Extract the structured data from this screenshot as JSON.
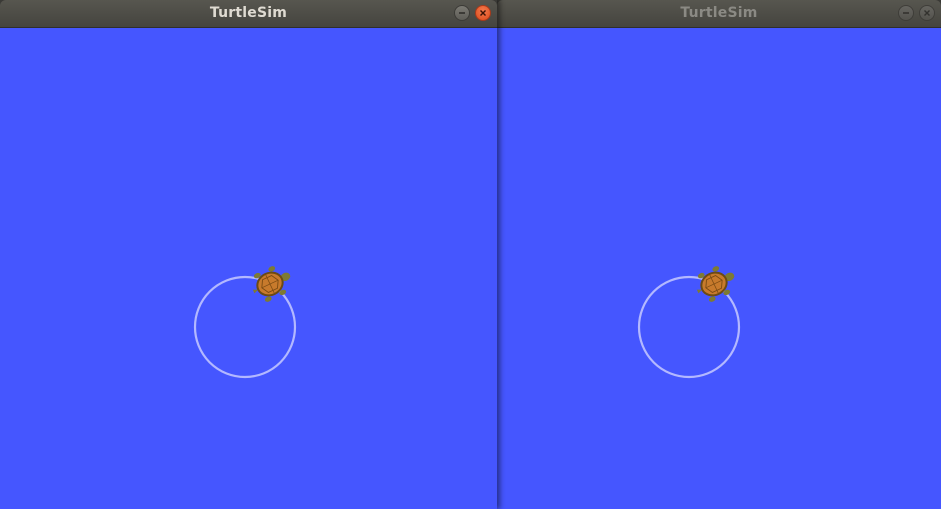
{
  "windows": [
    {
      "title": "TurtleSim",
      "state": "active",
      "background_color": "#4556ff",
      "pen_color": "#b3b8ff",
      "buttons": {
        "minimize": "minimize-icon",
        "close": "close-icon"
      }
    },
    {
      "title": "TurtleSim",
      "state": "inactive",
      "background_color": "#4556ff",
      "pen_color": "#b3b8ff",
      "buttons": {
        "minimize": "minimize-icon",
        "close": "close-icon"
      }
    }
  ],
  "colors": {
    "titlebar": "#4b4a45",
    "close_button": "#e4531f",
    "turtle_shell": "#c77a2c",
    "turtle_skin": "#7d7a33"
  },
  "icons": {
    "turtle": "turtle-icon"
  }
}
